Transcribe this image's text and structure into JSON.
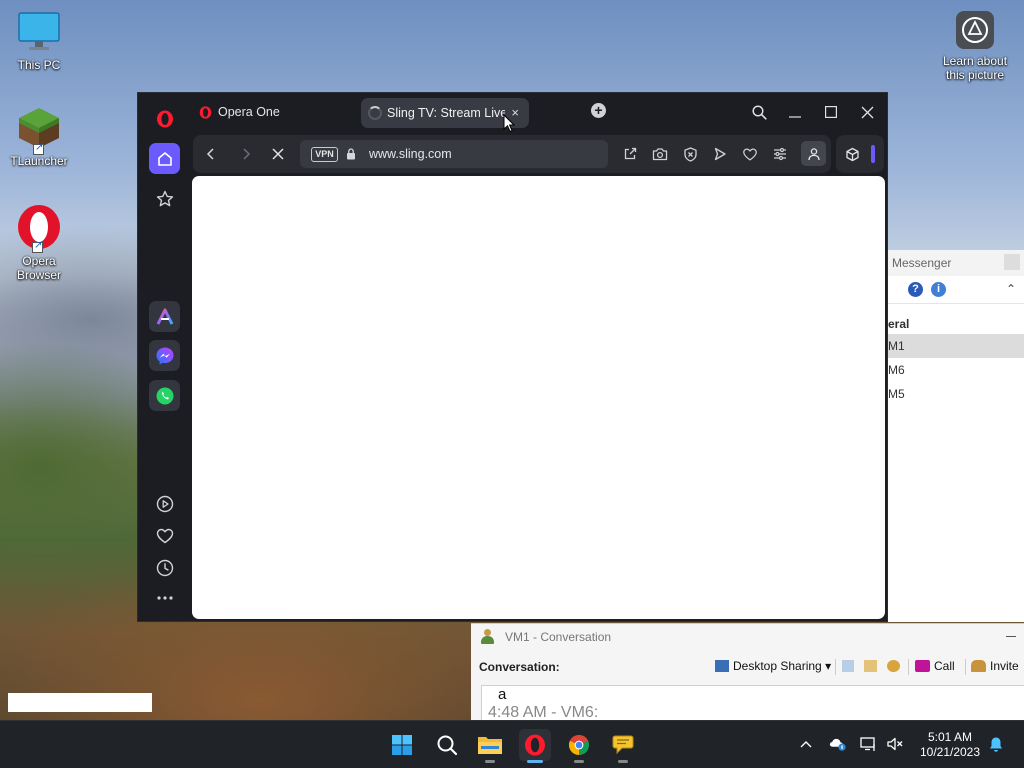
{
  "desktop": {
    "icons": [
      {
        "label": "This PC"
      },
      {
        "label": "TLauncher"
      },
      {
        "label": "Opera\nBrowser"
      },
      {
        "label": "Learn about\nthis picture"
      }
    ]
  },
  "browser": {
    "tabs": [
      {
        "label": "Opera One"
      },
      {
        "label": "Sling TV: Stream Live"
      }
    ],
    "address": {
      "vpn_label": "VPN",
      "url": "www.sling.com"
    },
    "accent_color": "#6b5bff"
  },
  "messenger": {
    "title": "Messenger",
    "group": "eral",
    "contacts": [
      "M1",
      "M6",
      "M5"
    ]
  },
  "conversation": {
    "title": "VM1 - Conversation",
    "label": "Conversation:",
    "buttons": {
      "desktop_sharing": "Desktop Sharing",
      "call": "Call",
      "invite": "Invite"
    },
    "lines": [
      "a",
      "4:48 AM - VM6:"
    ]
  },
  "taskbar": {
    "time": "5:01 AM",
    "date": "10/21/2023"
  }
}
